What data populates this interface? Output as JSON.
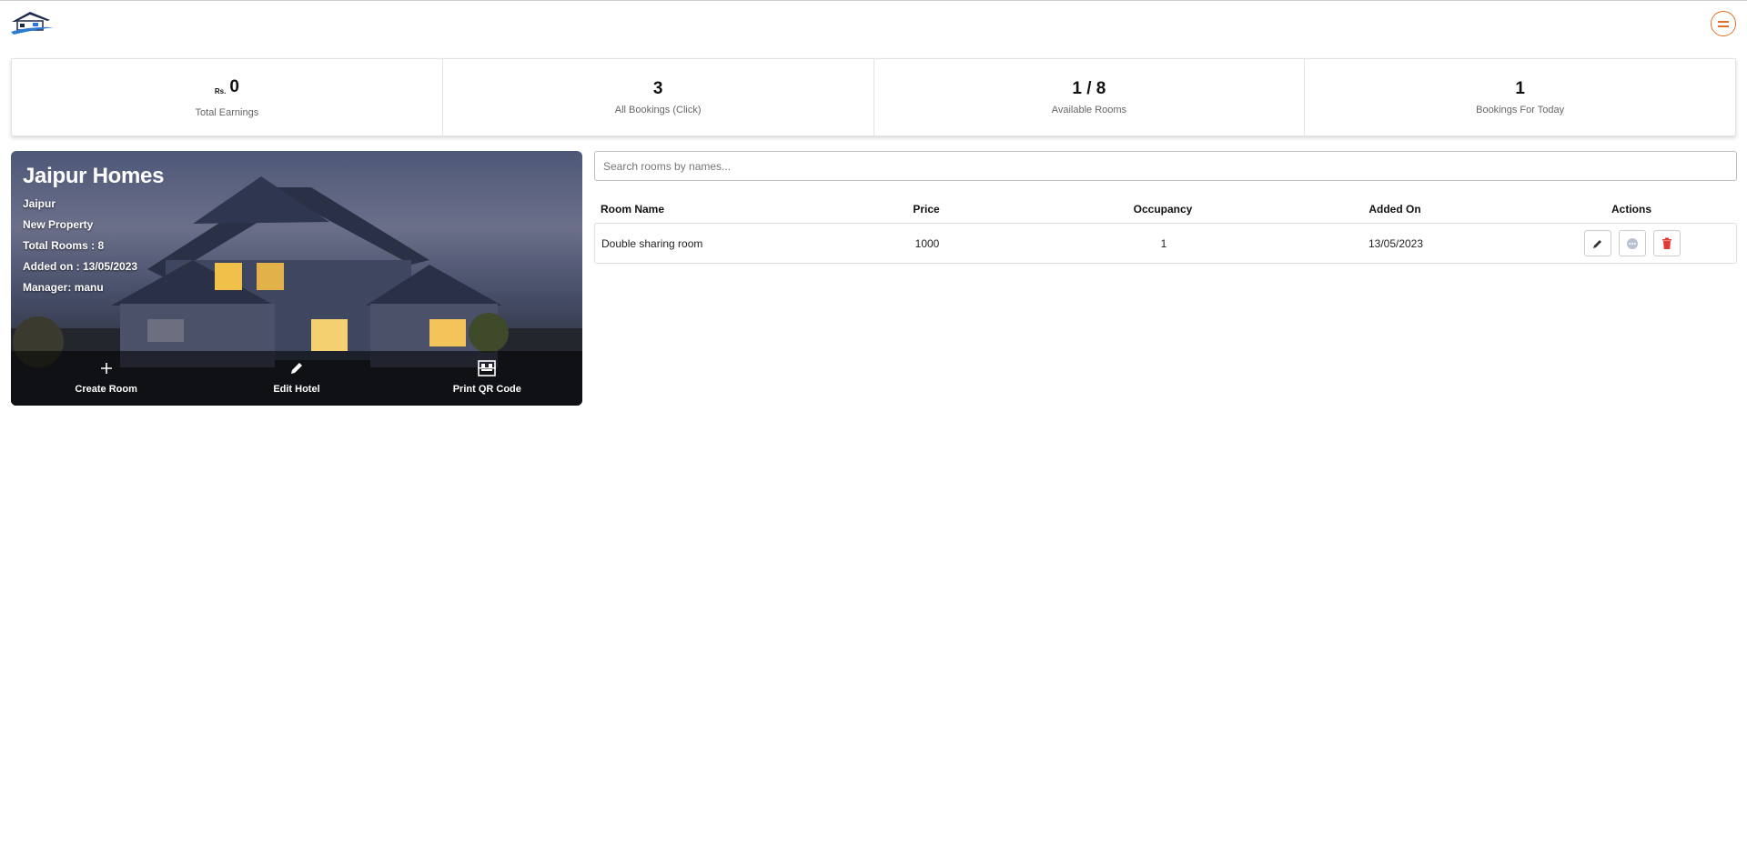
{
  "header": {
    "logo_icon": "house-logo-icon",
    "menu_icon": "menu-icon",
    "accent_color": "#e0702a"
  },
  "stats": [
    {
      "currency": "Rs.",
      "value": "0",
      "label": "Total Earnings"
    },
    {
      "value": "3",
      "label": "All Bookings (Click)"
    },
    {
      "value": "1 / 8",
      "label": "Available Rooms"
    },
    {
      "value": "1",
      "label": "Bookings For Today"
    }
  ],
  "hotel": {
    "name": "Jaipur Homes",
    "city": "Jaipur",
    "tag": "New Property",
    "total_rooms_label": "Total Rooms : ",
    "total_rooms": "8",
    "added_label": "Added on : ",
    "added_on": "13/05/2023",
    "manager_label": "Manager: ",
    "manager": "manu",
    "actions": [
      {
        "label": "Create Room",
        "icon": "plus-icon"
      },
      {
        "label": "Edit Hotel",
        "icon": "pencil-icon"
      },
      {
        "label": "Print QR Code",
        "icon": "qr-code-icon"
      }
    ]
  },
  "search": {
    "placeholder": "Search rooms by names..."
  },
  "table": {
    "headers": {
      "name": "Room Name",
      "price": "Price",
      "occupancy": "Occupancy",
      "added": "Added On",
      "actions": "Actions"
    },
    "rows": [
      {
        "name": "Double sharing room",
        "price": "1000",
        "occupancy": "1",
        "added": "13/05/2023",
        "actions": [
          "edit-icon",
          "more-icon",
          "delete-icon"
        ]
      }
    ],
    "delete_color": "#e53935"
  }
}
